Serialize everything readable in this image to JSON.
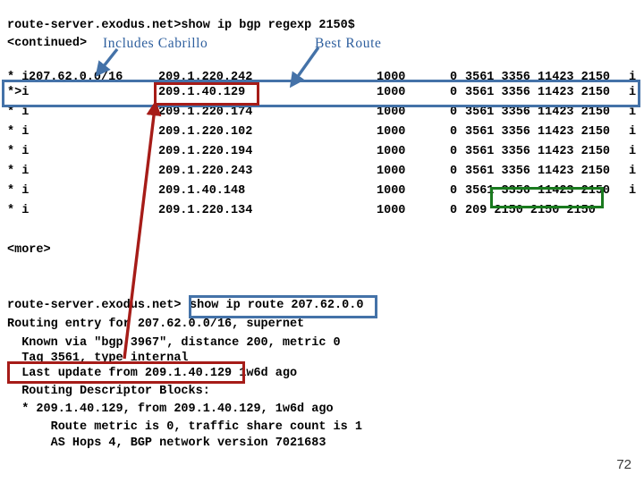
{
  "colors": {
    "blue_box": "#4472a8",
    "red_box": "#a61c18",
    "green_box": "#1a7a1f",
    "callout_text": "#2e5f9e",
    "terminal_text": "#000000",
    "background": "#ffffff"
  },
  "callouts": {
    "includes_cabrillo": "Includes Cabrillo",
    "best_route": "Best Route"
  },
  "bgp_session": {
    "prompt_line": "route-server.exodus.net>show ip bgp regexp 2150$",
    "continued_marker": "<continued>",
    "more_marker": "<more>",
    "rows": [
      {
        "flags": "* i",
        "network": "207.62.0.0/16",
        "next_hop": "209.1.220.242",
        "metric": "1000",
        "locprf": "0",
        "as_path": "3561 3356 11423 2150",
        "origin": "i"
      },
      {
        "flags": "*>i",
        "network": "",
        "next_hop": "209.1.40.129",
        "metric": "1000",
        "locprf": "0",
        "as_path": "3561 3356 11423 2150",
        "origin": "i"
      },
      {
        "flags": "* i",
        "network": "",
        "next_hop": "209.1.220.174",
        "metric": "1000",
        "locprf": "0",
        "as_path": "3561 3356 11423 2150",
        "origin": "i"
      },
      {
        "flags": "* i",
        "network": "",
        "next_hop": "209.1.220.102",
        "metric": "1000",
        "locprf": "0",
        "as_path": "3561 3356 11423 2150",
        "origin": "i"
      },
      {
        "flags": "* i",
        "network": "",
        "next_hop": "209.1.220.194",
        "metric": "1000",
        "locprf": "0",
        "as_path": "3561 3356 11423 2150",
        "origin": "i"
      },
      {
        "flags": "* i",
        "network": "",
        "next_hop": "209.1.220.243",
        "metric": "1000",
        "locprf": "0",
        "as_path": "3561 3356 11423 2150",
        "origin": "i"
      },
      {
        "flags": "* i",
        "network": "",
        "next_hop": "209.1.40.148",
        "metric": "1000",
        "locprf": "0",
        "as_path": "3561 3356 11423 2150",
        "origin": "i"
      },
      {
        "flags": "* i",
        "network": "",
        "next_hop": "209.1.220.134",
        "metric": "1000",
        "locprf": "0",
        "as_path": "209 2150 2150 2150",
        "origin": ""
      }
    ]
  },
  "route_session": {
    "prompt_prefix": "route-server.exodus.net>",
    "command": "show ip route 207.62.0.0",
    "lines": [
      "Routing entry for 207.62.0.0/16, supernet",
      "  Known via \"bgp 3967\", distance 200, metric 0",
      "  Tag 3561, type internal",
      "  Last update from 209.1.40.129 1w6d ago",
      "  Routing Descriptor Blocks:",
      "  * 209.1.40.129, from 209.1.40.129, 1w6d ago",
      "      Route metric is 0, traffic share count is 1",
      "      AS Hops 4, BGP network version 7021683"
    ],
    "highlighted_line": "Last update from 209.1.40.129"
  },
  "footer": {
    "page_number": "72"
  }
}
